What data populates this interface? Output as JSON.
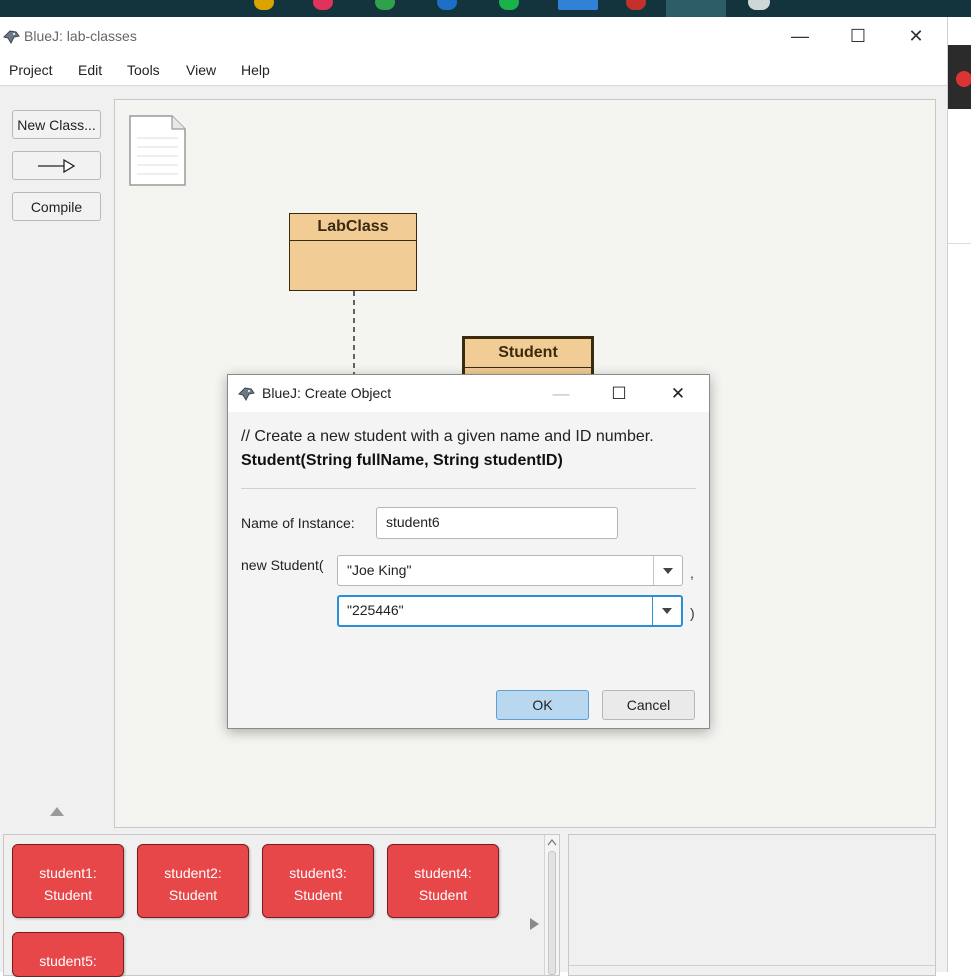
{
  "window": {
    "title": "BlueJ:  lab-classes",
    "controls": {
      "minimize": "—",
      "maximize": "☐",
      "close": "✕"
    }
  },
  "menu": [
    "Project",
    "Edit",
    "Tools",
    "View",
    "Help"
  ],
  "toolbar": {
    "new_class": "New Class...",
    "compile": "Compile"
  },
  "diagram": {
    "classes": [
      {
        "name": "LabClass"
      },
      {
        "name": "Student"
      }
    ]
  },
  "bench": {
    "objects": [
      {
        "line1": "student1:",
        "line2": "Student"
      },
      {
        "line1": "student2:",
        "line2": "Student"
      },
      {
        "line1": "student3:",
        "line2": "Student"
      },
      {
        "line1": "student4:",
        "line2": "Student"
      },
      {
        "line1": "student5:",
        "line2": ""
      }
    ]
  },
  "dialog": {
    "title": "BlueJ:  Create Object",
    "comment": "// Create a new student with a given name and ID number.",
    "signature": "Student(String fullName, String studentID)",
    "name_label": "Name of Instance:",
    "name_value": "student6",
    "constructor_label": "new Student(",
    "arg1_value": "\"Joe King\"",
    "arg1_suffix": ",",
    "arg2_value": "\"225446\"",
    "arg2_suffix": ")",
    "ok": "OK",
    "cancel": "Cancel"
  },
  "colors": {
    "class_fill": "#f1cc95",
    "object_fill": "#e8474a",
    "ok_fill": "#b9d7ef",
    "focus_border": "#2a8fd4"
  }
}
